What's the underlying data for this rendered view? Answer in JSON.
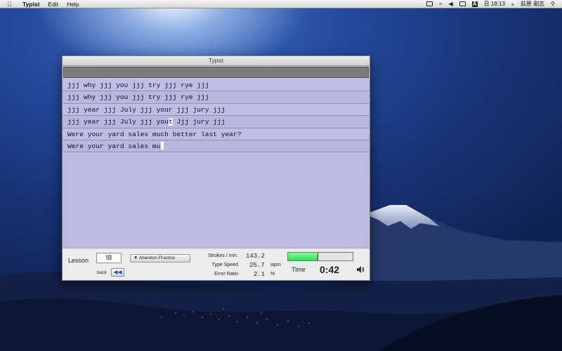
{
  "menubar": {
    "app_name": "Typist",
    "menus": [
      "Edit",
      "Help"
    ],
    "clock": "日 18:13",
    "user": "荻原 剛志",
    "input_method": "A"
  },
  "window": {
    "title": "Typist",
    "lines": [
      {
        "kind": "model",
        "text": "jjj why jjj you jjj try jjj rye jjj"
      },
      {
        "kind": "typed",
        "text": "jjj why jjj you jjj try jjj rye jjj"
      },
      {
        "kind": "model",
        "text": "jjj year jjj July jjj your jjj jury jjj"
      },
      {
        "kind": "typed",
        "text_before": "jjj year jjj July jjj you",
        "error_char": "t",
        "text_after": " Jjj jury jjj"
      },
      {
        "kind": "model",
        "text": "Were your yard sales much better last year?"
      },
      {
        "kind": "typed",
        "text": "Were your yard sales mu"
      }
    ]
  },
  "panel": {
    "lesson_label": "Lesson",
    "lesson_value": "t8",
    "back_label": "back",
    "back_button_glyph": "◀◀",
    "abandon_label": "▼ Abandon Practice",
    "strokes_label": "Strokes / min.",
    "strokes_value": "143.2",
    "speed_label": "Type Speed",
    "speed_value": "25.7",
    "speed_unit": "wpm",
    "error_label": "Error Ratio",
    "error_value": "2.1",
    "error_unit": "%",
    "time_label": "Time",
    "time_value": "0:42",
    "speed_meter_fraction": 0.47,
    "colors": {
      "meter_fill": "#2edc55",
      "text_bg": "#bcb9e2"
    }
  }
}
